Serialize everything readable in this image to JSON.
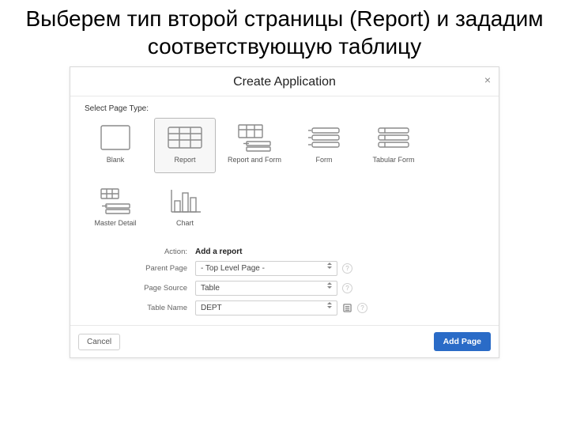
{
  "title": "Выберем тип второй страницы (Report) и зададим соответствующую таблицу",
  "dialog": {
    "title": "Create Application",
    "select_page_type": "Select Page Type:",
    "tiles": {
      "blank": "Blank",
      "report": "Report",
      "report_and_form": "Report and Form",
      "form": "Form",
      "tabular_form": "Tabular Form",
      "master_detail": "Master Detail",
      "chart": "Chart"
    },
    "form": {
      "action_label": "Action:",
      "action_value": "Add a report",
      "parent_label": "Parent Page",
      "parent_value": "- Top Level Page -",
      "source_label": "Page Source",
      "source_value": "Table",
      "table_label": "Table Name",
      "table_value": "DEPT"
    },
    "buttons": {
      "cancel": "Cancel",
      "add": "Add Page"
    }
  }
}
